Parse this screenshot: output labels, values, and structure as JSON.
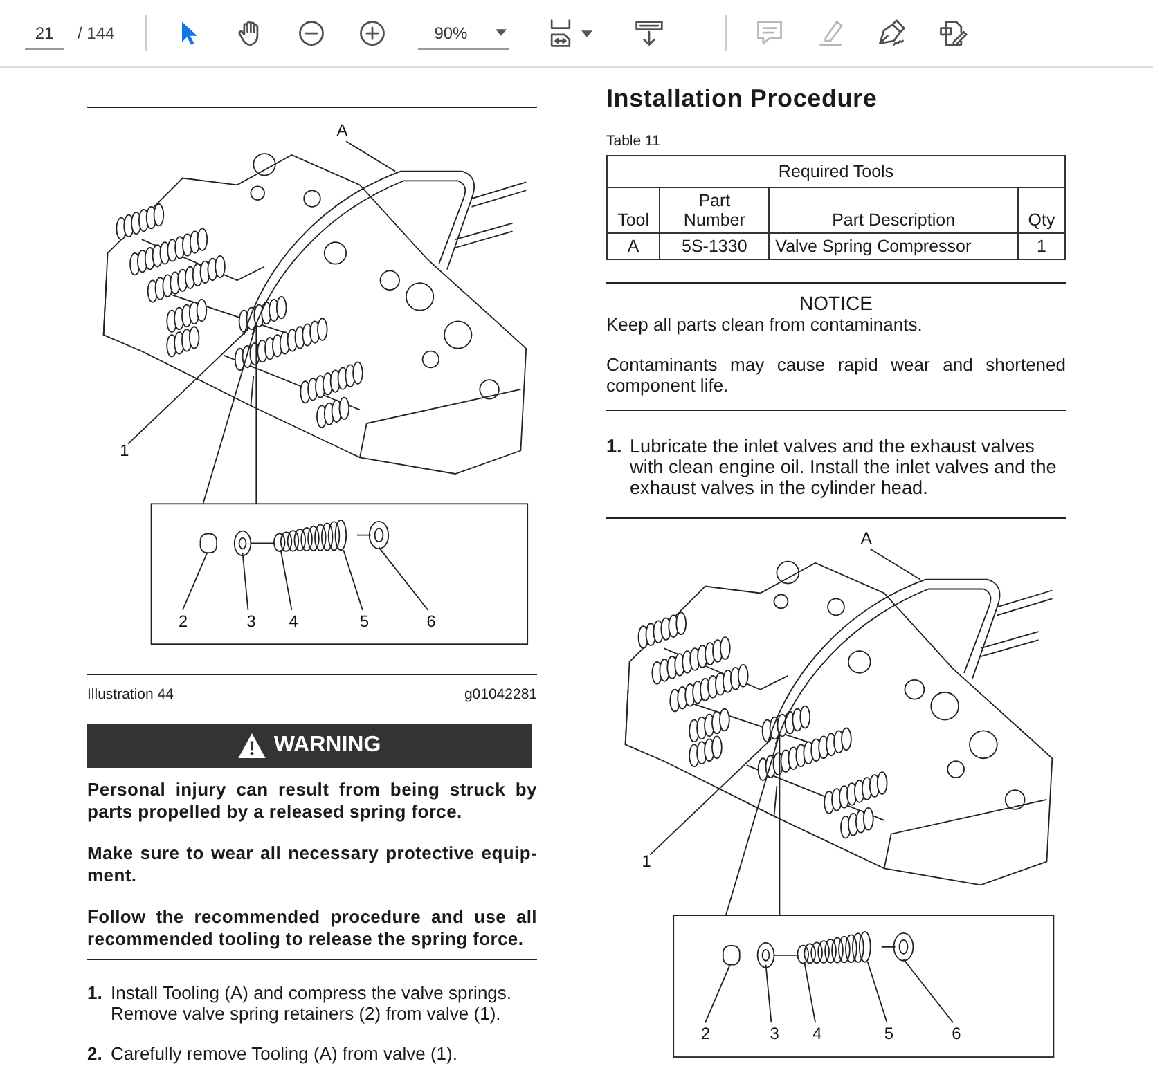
{
  "toolbar": {
    "page": {
      "current": "21",
      "total": "/ 144"
    },
    "nav_tools": [
      {
        "kind": "select",
        "selected": true
      },
      {
        "kind": "hand",
        "selected": false
      }
    ],
    "zoom_buttons": [
      {
        "kind": "zoom-out"
      },
      {
        "kind": "zoom-in"
      }
    ],
    "zoom": {
      "value": "90%"
    },
    "view_tools": [
      {
        "kind": "page-fit"
      },
      {
        "kind": "scroll"
      }
    ],
    "edit_tools": [
      {
        "kind": "comment",
        "disabled": true
      },
      {
        "kind": "highlight",
        "disabled": true
      },
      {
        "kind": "sign",
        "disabled": false
      },
      {
        "kind": "fill-sign",
        "disabled": false
      }
    ]
  },
  "left_column": [
    {
      "kind": "rule"
    },
    {
      "kind": "figure",
      "callouts": [
        "A",
        "1",
        "2",
        "3",
        "4",
        "5",
        "6"
      ]
    },
    {
      "kind": "rule"
    },
    {
      "kind": "caption",
      "label": "Illustration 44",
      "code": "g01042281"
    },
    {
      "kind": "warning",
      "title": "WARNING",
      "paragraphs": [
        "Personal injury can result from being struck by parts propelled by a released spring force.",
        "Make sure to wear all necessary protective equip- ment.",
        "Follow the recommended procedure and use all recommended tooling to release the spring force."
      ]
    },
    {
      "kind": "rule"
    },
    {
      "kind": "steps",
      "items": [
        {
          "number": "1.",
          "text": "Install Tooling (A) and compress the valve springs. Remove valve spring retainers (2) from valve (1)."
        },
        {
          "number": "2.",
          "text": "Carefully remove Tooling (A) from valve (1)."
        }
      ]
    }
  ],
  "right_column": [
    {
      "kind": "heading",
      "text": "Installation Procedure"
    },
    {
      "kind": "table",
      "caption": "Table 11",
      "title": "Required Tools",
      "columns": [
        "Tool",
        "Part Number",
        "Part Description",
        "Qty"
      ],
      "rows": [
        [
          "A",
          "5S-1330",
          "Valve Spring Compressor",
          "1"
        ]
      ]
    },
    {
      "kind": "rule"
    },
    {
      "kind": "notice",
      "title": "NOTICE",
      "paragraphs": [
        "Keep all parts clean from contaminants.",
        "Contaminants may cause rapid wear and shortened component life."
      ]
    },
    {
      "kind": "rule"
    },
    {
      "kind": "steps",
      "items": [
        {
          "number": "1.",
          "text": "Lubricate the inlet valves and the exhaust valves with clean engine oil. Install the inlet valves and the exhaust valves in the cylinder head."
        }
      ]
    },
    {
      "kind": "rule"
    },
    {
      "kind": "figure",
      "callouts": [
        "A",
        "1",
        "2",
        "3",
        "4",
        "5",
        "6"
      ]
    }
  ]
}
